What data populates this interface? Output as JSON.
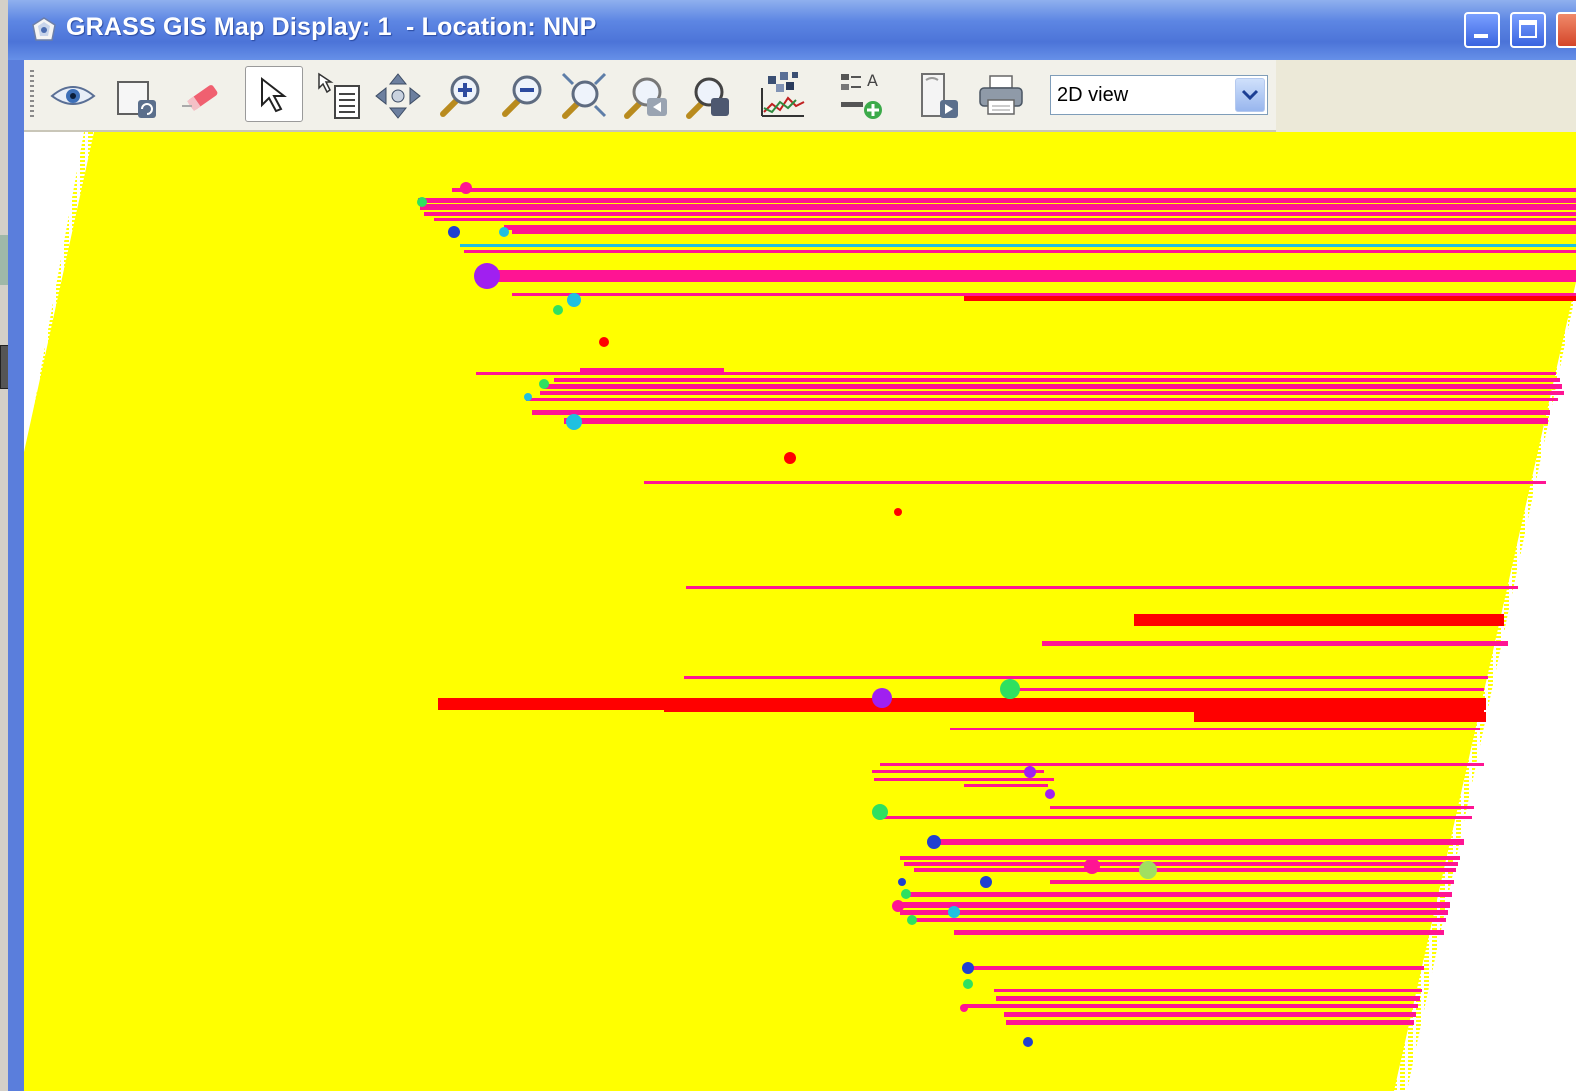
{
  "window": {
    "title": "GRASS GIS Map Display: 1  - Location: NNP",
    "controls": [
      "minimize",
      "maximize",
      "close"
    ]
  },
  "toolbar": {
    "tools": [
      {
        "name": "display-map-icon",
        "label": "Display map"
      },
      {
        "name": "render-map-icon",
        "label": "Re-render map"
      },
      {
        "name": "erase-display-icon",
        "label": "Erase display"
      },
      {
        "name": "pointer-icon",
        "label": "Pointer",
        "active": true
      },
      {
        "name": "query-icon",
        "label": "Query"
      },
      {
        "name": "pan-icon",
        "label": "Pan"
      },
      {
        "name": "zoom-in-icon",
        "label": "Zoom in"
      },
      {
        "name": "zoom-out-icon",
        "label": "Zoom out"
      },
      {
        "name": "zoom-extent-icon",
        "label": "Zoom to map extent"
      },
      {
        "name": "zoom-back-icon",
        "label": "Return to previous zoom"
      },
      {
        "name": "zoom-menu-icon",
        "label": "Zoom options"
      },
      {
        "name": "analyze-icon",
        "label": "Analyze map"
      },
      {
        "name": "overlay-icon",
        "label": "Add map elements"
      },
      {
        "name": "save-map-icon",
        "label": "Save display to graphic file"
      },
      {
        "name": "print-icon",
        "label": "Print display"
      }
    ],
    "view_mode": {
      "selected": "2D view"
    }
  },
  "map": {
    "background_color": "#ffff00",
    "colors": {
      "magenta": "#ff1493",
      "red": "#ff0000",
      "purple": "#a020f0",
      "cyan": "#20c0e0",
      "green": "#30e060",
      "blue": "#2040d0",
      "lightgreen": "#a0e060"
    }
  }
}
